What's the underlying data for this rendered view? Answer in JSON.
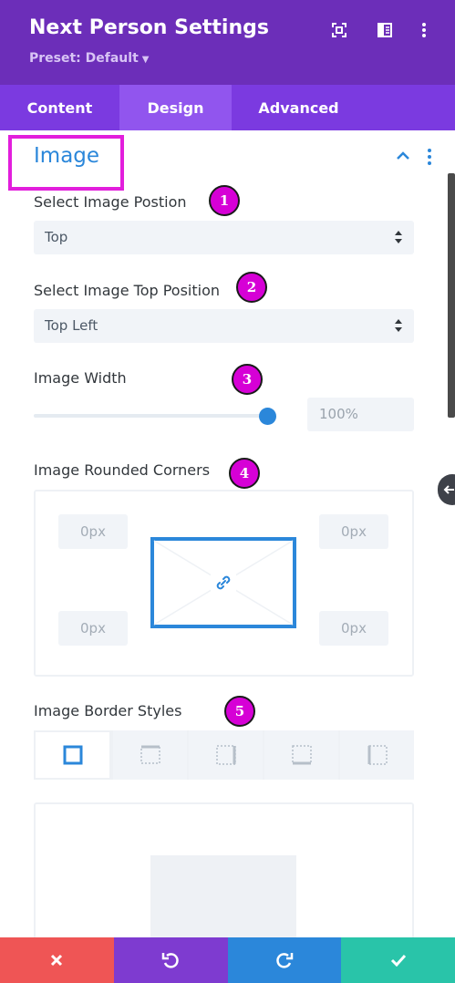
{
  "header": {
    "title": "Next Person Settings",
    "preset": "Preset: Default",
    "icons": [
      "focus-icon",
      "split-view-icon",
      "more-vertical-icon"
    ]
  },
  "tabs": [
    {
      "label": "Content",
      "active": false
    },
    {
      "label": "Design",
      "active": true
    },
    {
      "label": "Advanced",
      "active": false
    }
  ],
  "section": {
    "title": "Image"
  },
  "fields": {
    "image_position": {
      "label": "Select Image Postion",
      "value": "Top",
      "badge": "1"
    },
    "image_top_position": {
      "label": "Select Image Top Position",
      "value": "Top Left",
      "badge": "2"
    },
    "image_width": {
      "label": "Image Width",
      "value": "100%",
      "slider_fraction": 1.0,
      "badge": "3"
    },
    "rounded_corners": {
      "label": "Image Rounded Corners",
      "badge": "4",
      "top_left": "0px",
      "top_right": "0px",
      "bottom_left": "0px",
      "bottom_right": "0px"
    },
    "border_styles": {
      "label": "Image Border Styles",
      "badge": "5",
      "options": [
        "all-borders",
        "top-border",
        "right-border",
        "bottom-border",
        "left-border"
      ],
      "selected": "all-borders"
    }
  },
  "bottom_bar": [
    {
      "name": "discard",
      "color": "#ef5555"
    },
    {
      "name": "undo",
      "color": "#7e3bd0"
    },
    {
      "name": "redo",
      "color": "#2b87da"
    },
    {
      "name": "save",
      "color": "#29c4a9"
    }
  ],
  "colors": {
    "header": "#6c2eb9",
    "tabs": "#7b3ae0",
    "active_tab": "#9155ee",
    "accent": "#2b87da",
    "annotation": "#d600d6"
  }
}
